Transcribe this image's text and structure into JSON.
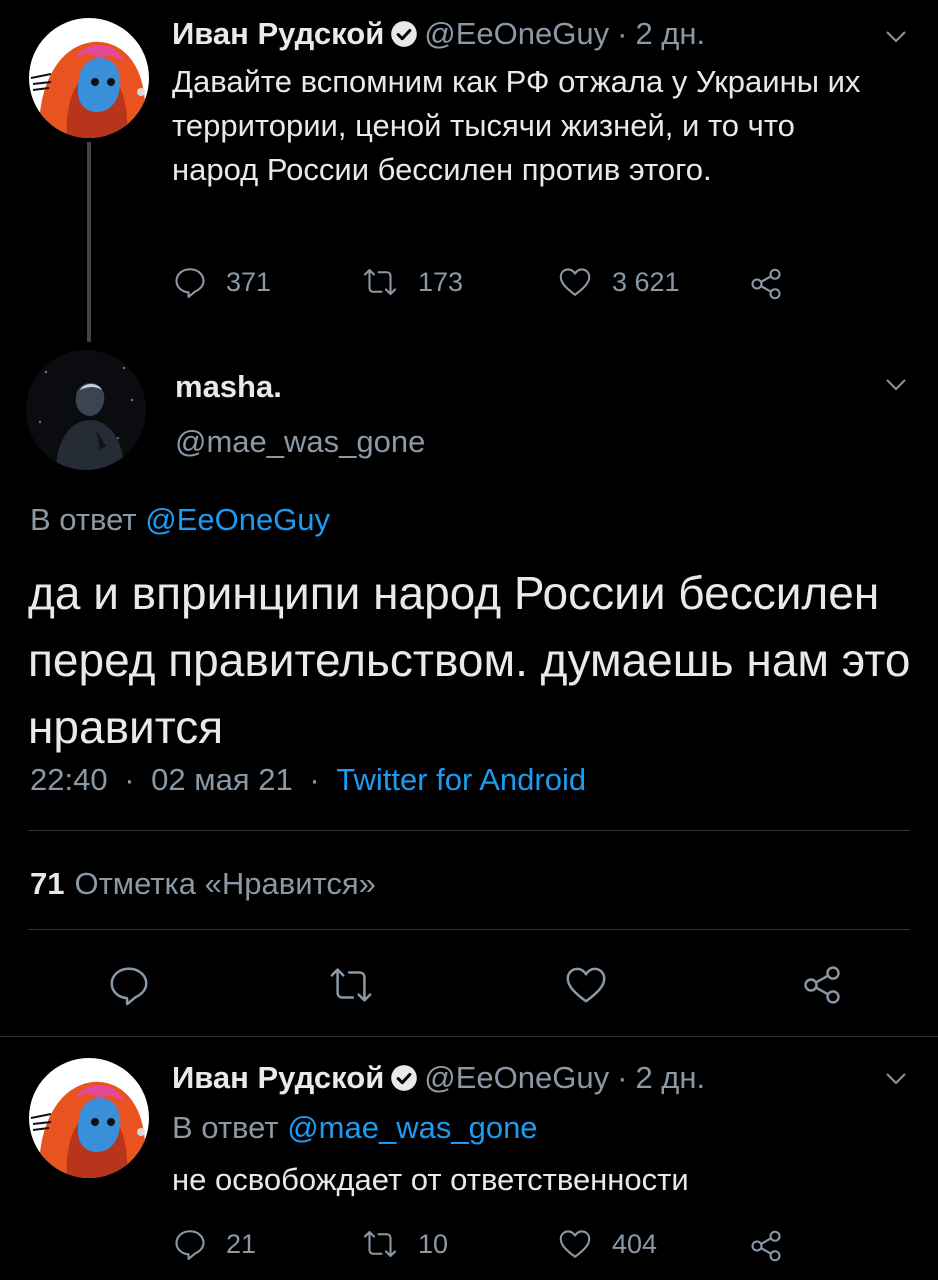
{
  "tweet1": {
    "display_name": "Иван Рудской",
    "handle": "@EeOneGuy",
    "separator": "·",
    "ago": "2 дн.",
    "text": "Давайте вспомним как РФ отжала у Украины их территории, ценой тысячи жизней, и то что народ России бессилен против этого.",
    "replies": "371",
    "retweets": "173",
    "likes": "3 621"
  },
  "focused": {
    "display_name": "masha.",
    "handle": "@mae_was_gone",
    "reply_prefix": "В ответ",
    "reply_to": "@EeOneGuy",
    "text": "да и впринципи народ России бессилен перед правительством. думаешь нам это нравится",
    "time": "22:40",
    "separator": "·",
    "date": "02 мая 21",
    "source": "Twitter for Android",
    "likes_count": "71",
    "likes_label": "Отметка «Нравится»"
  },
  "tweet3": {
    "display_name": "Иван Рудской",
    "handle": "@EeOneGuy",
    "separator": "·",
    "ago": "2 дн.",
    "reply_prefix": "В ответ",
    "reply_to": "@mae_was_gone",
    "text": "не освобождает от ответственности",
    "replies": "21",
    "retweets": "10",
    "likes": "404"
  },
  "colors": {
    "background": "#000000",
    "primary_text": "#e7e9ea",
    "secondary_text": "#8b98a5",
    "link": "#1d9bf0",
    "divider": "#2f3336"
  },
  "icons": [
    "verified-badge-icon",
    "chevron-down-icon",
    "reply-icon",
    "retweet-icon",
    "like-heart-icon",
    "share-icon"
  ]
}
